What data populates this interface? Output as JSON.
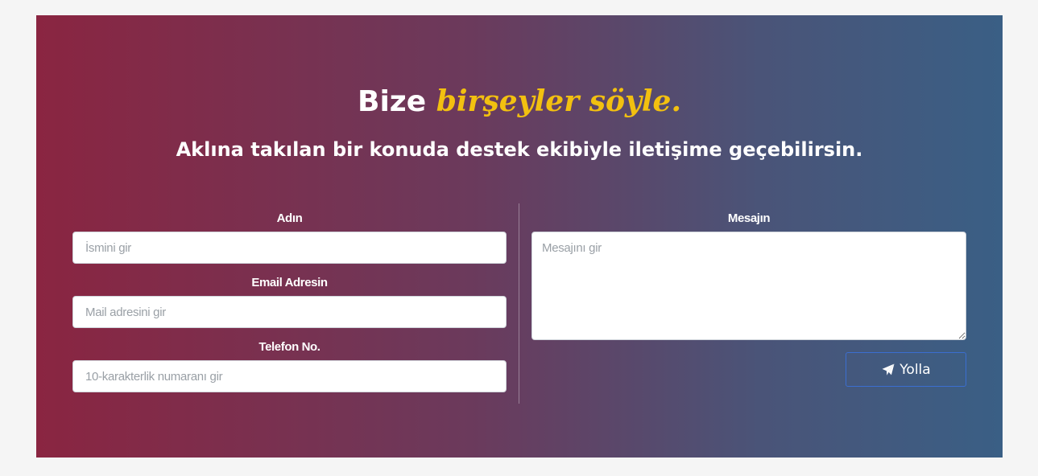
{
  "header": {
    "title_plain": "Bize",
    "title_accent": "birşeyler söyle.",
    "subtitle": "Aklına takılan bir konuda destek ekibiyle iletişime geçebilirsin."
  },
  "form": {
    "name": {
      "label": "Adın",
      "placeholder": "İsmini gir",
      "value": ""
    },
    "email": {
      "label": "Email Adresin",
      "placeholder": "Mail adresini gir",
      "value": ""
    },
    "phone": {
      "label": "Telefon No.",
      "placeholder": "10-karakterlik numaranı gir",
      "value": ""
    },
    "message": {
      "label": "Mesajın",
      "placeholder": "Mesajını gir",
      "value": ""
    },
    "submit": {
      "label": "Yolla",
      "icon": "paper-plane-icon"
    }
  },
  "colors": {
    "page_background": "#f5f5f5",
    "gradient_start": "#8a2541",
    "gradient_end": "#3a5f85",
    "accent_text": "#f2c010",
    "button_border": "#3b6ed0"
  }
}
